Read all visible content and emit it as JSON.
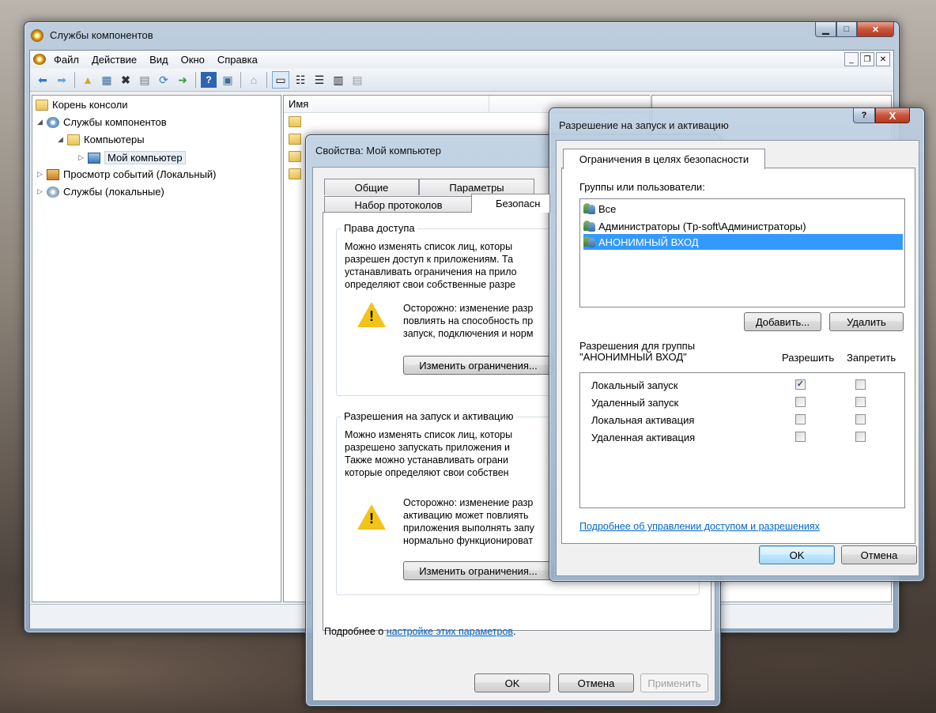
{
  "main_window": {
    "title": "Службы компонентов",
    "menu": [
      "Файл",
      "Действие",
      "Вид",
      "Окно",
      "Справка"
    ],
    "tree": {
      "root": "Корень консоли",
      "component_services": "Службы компонентов",
      "computers": "Компьютеры",
      "my_computer": "Мой компьютер",
      "event_viewer": "Просмотр событий (Локальный)",
      "services": "Службы (локальные)"
    },
    "list_header": "Имя"
  },
  "props_dialog": {
    "title": "Свойства: Мой компьютер",
    "tabs_row1": [
      "Общие",
      "Параметры"
    ],
    "tabs_row2": [
      "Набор протоколов",
      "Безопасн"
    ],
    "access_group": {
      "label": "Права доступа",
      "text": "Можно изменять список лиц, которы\nразрешен доступ к приложениям. Та\nустанавливать ограничения на прило\nопределяют свои собственные разре",
      "warning": "Осторожно: изменение разр\nповлиять на способность пр\nзапуск, подключения и норм",
      "button": "Изменить ограничения..."
    },
    "launch_group": {
      "label": "Разрешения на запуск и активацию",
      "text": "Можно изменять список лиц, которы\nразрешено запускать приложения и\nТакже можно устанавливать ограни\nкоторые определяют свои собствен",
      "warning": "Осторожно: изменение разр\nактивацию может повлиять\nприложения выполнять запу\nнормально функционироват",
      "button": "Изменить ограничения..."
    },
    "footer_prefix": "Подробнее о ",
    "footer_link": "настройке этих параметров",
    "footer_suffix": ".",
    "ok": "OK",
    "cancel": "Отмена",
    "apply": "Применить"
  },
  "perm_dialog": {
    "title": "Разрешение на запуск и активацию",
    "help_glyph": "?",
    "close_glyph": "X",
    "tab": "Ограничения в целях безопасности",
    "groups_label": "Группы или пользователи:",
    "users": [
      {
        "name": "Все"
      },
      {
        "name": "Администраторы (Tp-soft\\Администраторы)"
      },
      {
        "name": "АНОНИМНЫЙ ВХОД"
      }
    ],
    "add_button": "Добавить...",
    "remove_button": "Удалить",
    "perms_for_label": "Разрешения для группы",
    "perms_for_group": "\"АНОНИМНЫЙ ВХОД\"",
    "allow_header": "Разрешить",
    "deny_header": "Запретить",
    "permissions": [
      {
        "name": "Локальный запуск",
        "allow": true,
        "deny": false
      },
      {
        "name": "Удаленный запуск",
        "allow": false,
        "deny": false
      },
      {
        "name": "Локальная активация",
        "allow": false,
        "deny": false
      },
      {
        "name": "Удаленная активация",
        "allow": false,
        "deny": false
      }
    ],
    "learn_more": "Подробнее об управлении доступом и разрешениях",
    "ok": "OK",
    "cancel": "Отмена"
  }
}
